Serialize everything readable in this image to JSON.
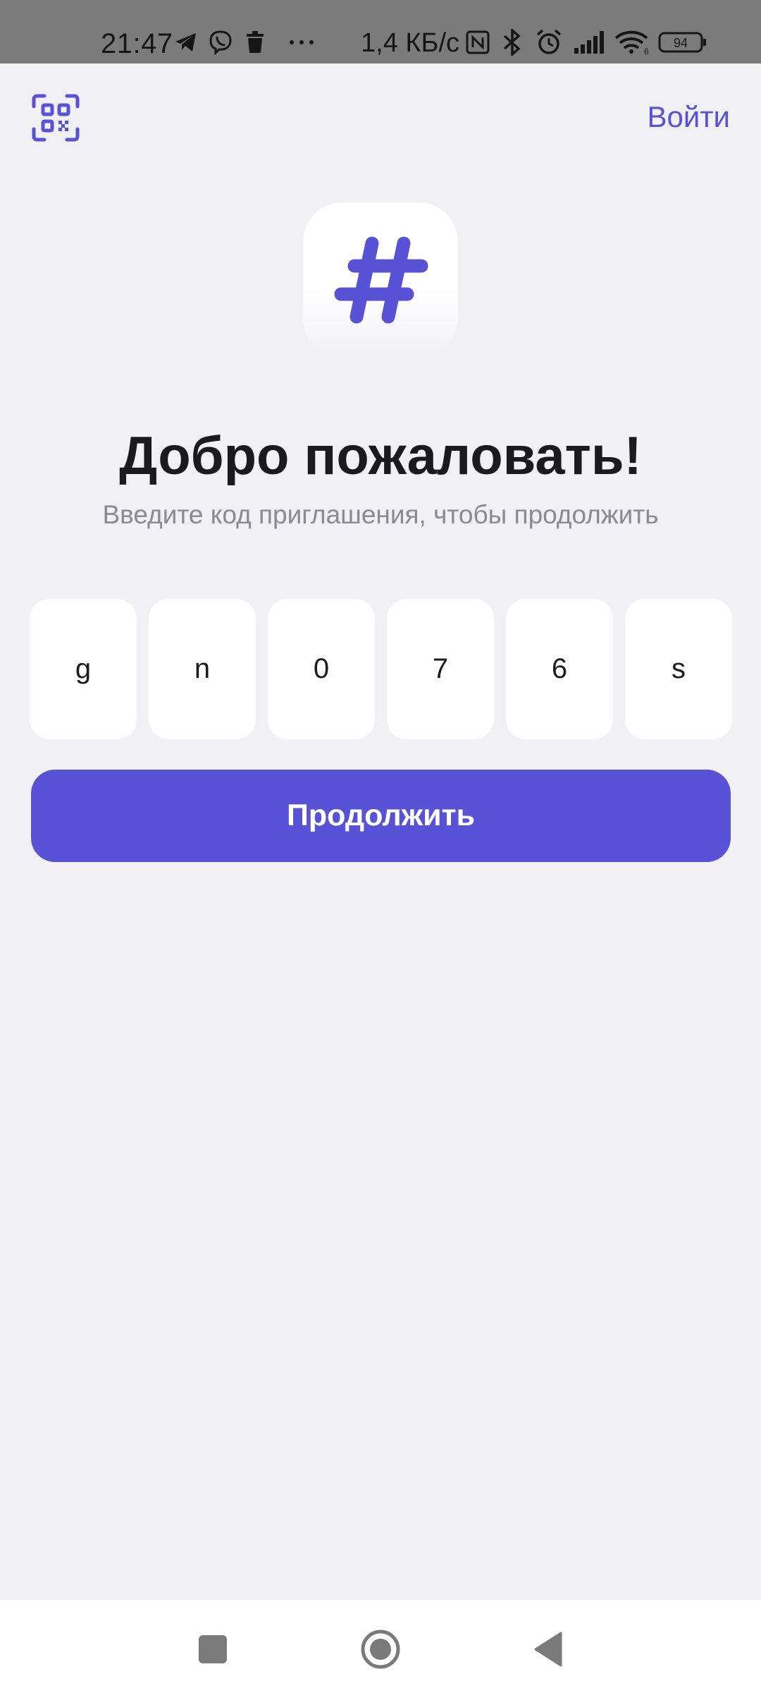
{
  "status_bar": {
    "time": "21:47",
    "network_speed": "1,4 КБ/с",
    "battery": "94",
    "icons": [
      "telegram-icon",
      "viber-icon",
      "trash-icon",
      "more-icon",
      "nfc-icon",
      "bluetooth-icon",
      "alarm-icon",
      "signal-icon",
      "wifi-icon",
      "battery-icon"
    ]
  },
  "header": {
    "login_label": "Войти",
    "qr_icon": "qr-scan-icon"
  },
  "welcome": {
    "title": "Добро пожаловать!",
    "subtitle": "Введите код приглашения, чтобы продолжить"
  },
  "invite_code": {
    "chars": [
      "g",
      "n",
      "0",
      "7",
      "6",
      "s"
    ]
  },
  "continue_label": "Продолжить",
  "colors": {
    "accent": "#5853d6",
    "background": "#f1f0f5",
    "status_bar": "#7b7b7b"
  },
  "navigation": {
    "icons": [
      "recents-square-icon",
      "home-circle-icon",
      "back-triangle-icon"
    ]
  }
}
